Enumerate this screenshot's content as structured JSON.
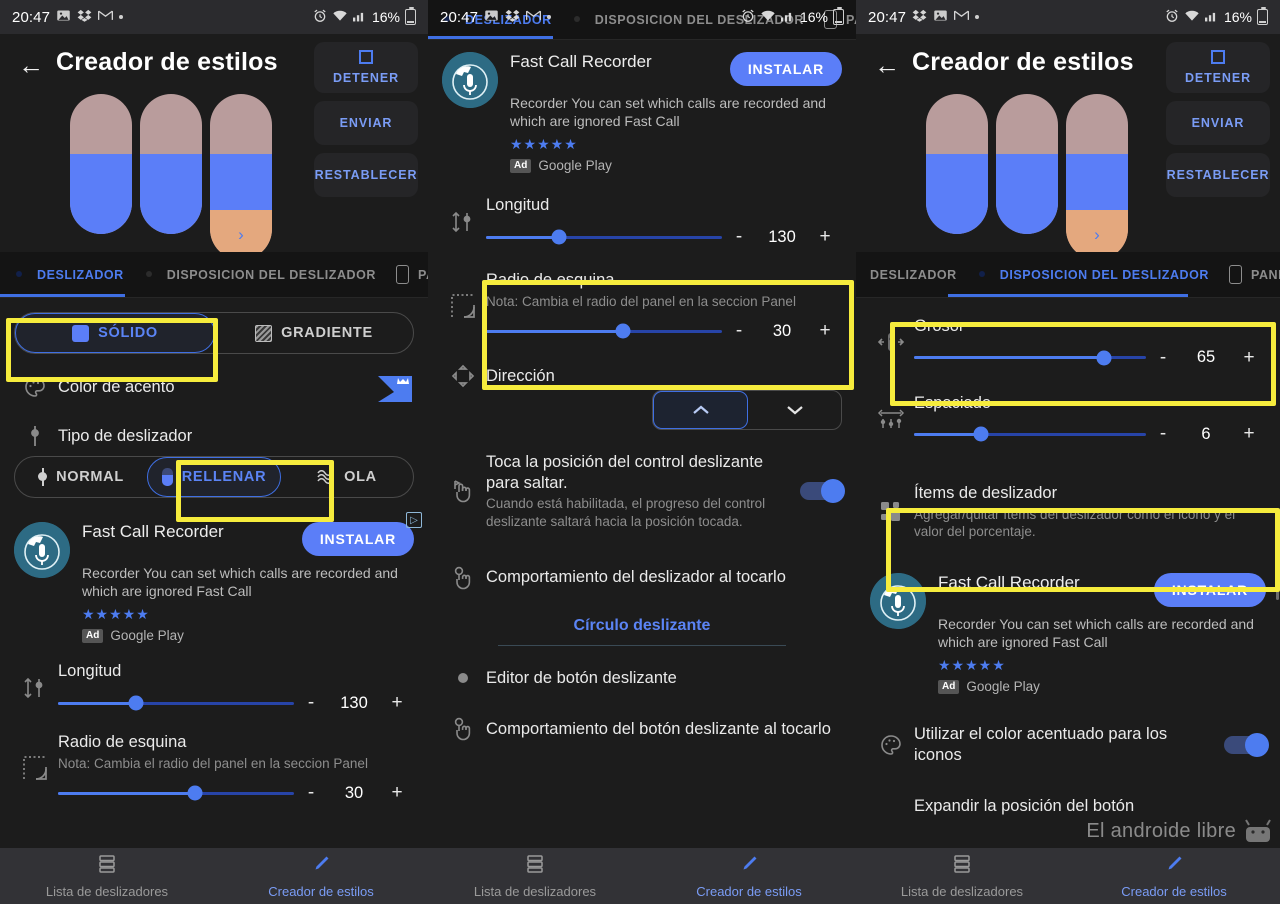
{
  "status_bar": {
    "time": "20:47",
    "left_icons": [
      "photos-icon",
      "dropbox-icon",
      "gmail-icon",
      "dot-indicator"
    ],
    "right_icons": [
      "alarm-icon",
      "wifi-icon",
      "signal-icon"
    ],
    "battery_percent": "16%"
  },
  "app": {
    "title": "Creador de estilos",
    "back_icon": "back-arrow-icon"
  },
  "actions": {
    "stop": "DETENER",
    "send": "ENVIAR",
    "reset": "RESTABLECER"
  },
  "tabs": {
    "slider": "DESLIZADOR",
    "layout": "DISPOSICION DEL DESLIZADOR",
    "panel": "PANEL",
    "panel_short": "PA"
  },
  "bottom_nav": {
    "list": "Lista de deslizadores",
    "creator": "Creador de estilos"
  },
  "ad": {
    "title": "Fast Call Recorder",
    "install": "INSTALAR",
    "description": "Recorder You can set which calls are recorded and which are ignored Fast Call",
    "stars": "★★★★★",
    "badge": "Ad",
    "source": "Google Play"
  },
  "watermark": "El androide libre",
  "screen1": {
    "mode_segmented": {
      "solid": "SÓLIDO",
      "gradient": "GRADIENTE",
      "selected": "SÓLIDO"
    },
    "accent_color": "Color de acento",
    "slider_type_label": "Tipo de deslizador",
    "slider_type_segmented": {
      "normal": "NORMAL",
      "fill": "RELLENAR",
      "wave": "OLA",
      "selected": "RELLENAR"
    },
    "length": {
      "label": "Longitud",
      "value": "130",
      "percent": 33,
      "minus": "-",
      "plus": "+"
    },
    "corner_radius": {
      "label": "Radio de esquina",
      "note": "Nota: Cambia el radio del panel en la seccion Panel",
      "value": "30",
      "percent": 58,
      "minus": "-",
      "plus": "+"
    }
  },
  "screen2": {
    "length": {
      "label": "Longitud",
      "value": "130",
      "percent": 31,
      "minus": "-",
      "plus": "+"
    },
    "corner_radius": {
      "label": "Radio de esquina",
      "note": "Nota: Cambia el radio del panel en la seccion Panel",
      "value": "30",
      "percent": 58,
      "minus": "-",
      "plus": "+"
    },
    "direction": {
      "label": "Dirección",
      "up": "⌃",
      "down": "⌄",
      "selected": "up"
    },
    "tap_to_seek": {
      "label": "Toca la posición del control deslizante para saltar.",
      "note": "Cuando está habilitada, el progreso del control deslizante saltará hacia la posición tocada.",
      "enabled": true
    },
    "slider_tap_behavior": "Comportamiento del deslizador al tocarlo",
    "section_title": "Círculo deslizante",
    "button_editor": "Editor de botón deslizante",
    "button_tap_behavior": "Comportamiento del botón deslizante al tocarlo"
  },
  "screen3": {
    "thickness": {
      "label": "Grosor",
      "value": "65",
      "percent": 82,
      "minus": "-",
      "plus": "+"
    },
    "spacing": {
      "label": "Espaciado",
      "value": "6",
      "percent": 29,
      "minus": "-",
      "plus": "+"
    },
    "slider_items": {
      "label": "Ítems de deslizador",
      "note": "Agregar/quitar ítems del deslizador como el icono y el valor del porcentaje."
    },
    "use_accent_icons": {
      "label": "Utilizar el color acentuado para los iconos",
      "enabled": true
    },
    "expand_button": "Expandir la posición del botón"
  },
  "colors": {
    "accent": "#4d7cf0",
    "highlight": "#f6ec3d",
    "background": "#1c1c1c",
    "pill_top": "#b99c9c",
    "pill_fill": "#5b7ef8",
    "pill_tail": "#e4a87e"
  }
}
